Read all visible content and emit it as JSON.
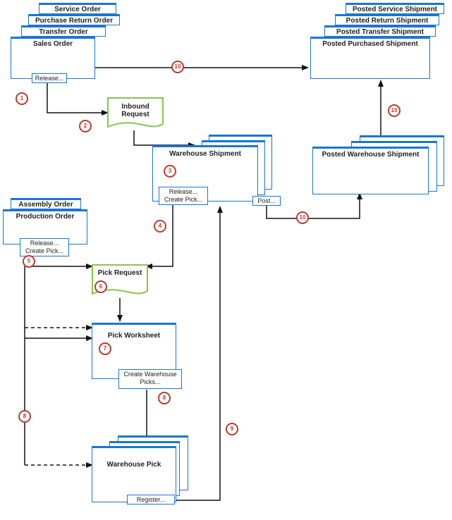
{
  "orders": {
    "service": "Service Order",
    "purchaseReturn": "Purchase Return Order",
    "transfer": "Transfer Order",
    "sales": "Sales Order",
    "releaseBtn": "Release..."
  },
  "inboundRequest": "Inbound Request",
  "warehouseShipment": {
    "title": "Warehouse Shipment",
    "releaseBtn": "Release...\nCreate Pick...",
    "postBtn": "Post..."
  },
  "postedShipments": {
    "service": "Posted Service Shipment",
    "return": "Posted Return Shipment",
    "transfer": "Posted Transfer Shipment",
    "purchased": "Posted Purchased Shipment"
  },
  "postedWarehouseShipment": "Posted Warehouse Shipment",
  "productionOrders": {
    "assembly": "Assembly Order",
    "production": "Production Order",
    "btn": "Release...\nCreate Pick..."
  },
  "pickRequest": "Pick Request",
  "pickWorksheet": {
    "title": "Pick Worksheet",
    "btn": "Create Warehouse\nPicks..."
  },
  "warehousePick": {
    "title": "Warehouse Pick",
    "btn": "Register..."
  },
  "badges": {
    "b1": "1",
    "b2": "2",
    "b3": "3",
    "b4": "4",
    "b5": "5",
    "b6": "6",
    "b7": "7",
    "b8a": "8",
    "b8b": "8",
    "b9": "9",
    "b10a": "10",
    "b10b": "10",
    "b10c": "10"
  }
}
